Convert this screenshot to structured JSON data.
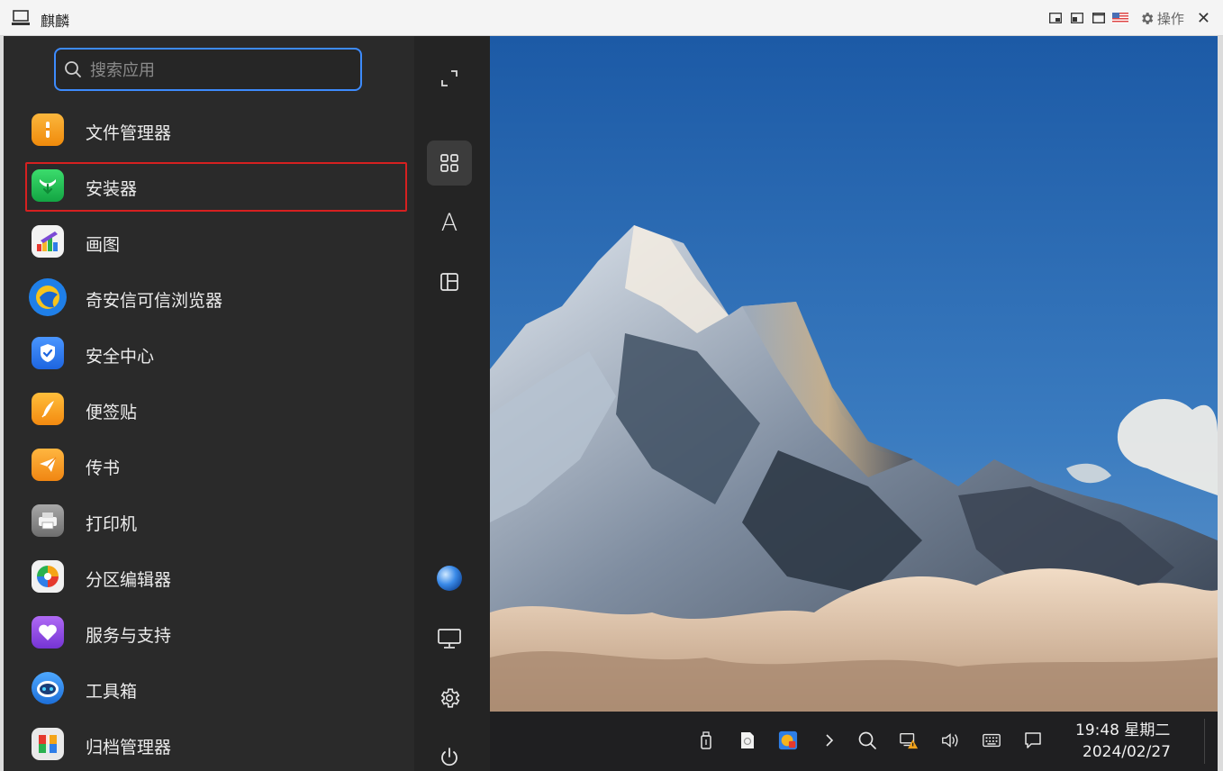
{
  "window": {
    "title": "麒麟",
    "action_label": "操作",
    "close_glyph": "✕"
  },
  "menu": {
    "search": {
      "placeholder": "搜索应用",
      "value": ""
    },
    "apps": [
      {
        "label": "文件管理器",
        "icon": "folder-icon",
        "color": "#f7a21b"
      },
      {
        "label": "安装器",
        "icon": "installer-icon",
        "color": "#23c25a",
        "highlighted": true
      },
      {
        "label": "画图",
        "icon": "paint-icon",
        "color": "#e9e9e9"
      },
      {
        "label": "奇安信可信浏览器",
        "icon": "browser-icon",
        "color": "#1f7fe8"
      },
      {
        "label": "安全中心",
        "icon": "shield-icon",
        "color": "#2f7ef0"
      },
      {
        "label": "便签贴",
        "icon": "note-icon",
        "color": "#f8a11c"
      },
      {
        "label": "传书",
        "icon": "send-icon",
        "color": "#f59d1e"
      },
      {
        "label": "打印机",
        "icon": "printer-icon",
        "color": "#8c8c8c"
      },
      {
        "label": "分区编辑器",
        "icon": "partition-icon",
        "color": "#f1f1f1"
      },
      {
        "label": "服务与支持",
        "icon": "heart-icon",
        "color": "#8f4ae0"
      },
      {
        "label": "工具箱",
        "icon": "robot-icon",
        "color": "#2c8ee8"
      },
      {
        "label": "归档管理器",
        "icon": "archive-icon",
        "color": "#e8e8e8"
      }
    ],
    "sidebar": [
      "expand-icon",
      "grid-icon",
      "letter-a-icon",
      "category-icon",
      "user-avatar",
      "monitor-icon",
      "settings-icon",
      "power-icon"
    ],
    "sidebar_letter": "A"
  },
  "taskbar": {
    "tray": [
      "usb-icon",
      "clipboard-icon",
      "app-tray-icon",
      "chevron-right-icon",
      "search-icon",
      "network-warning-icon",
      "volume-icon",
      "keyboard-icon",
      "notification-icon"
    ],
    "time": "19:48 星期二",
    "date": "2024/02/27"
  }
}
